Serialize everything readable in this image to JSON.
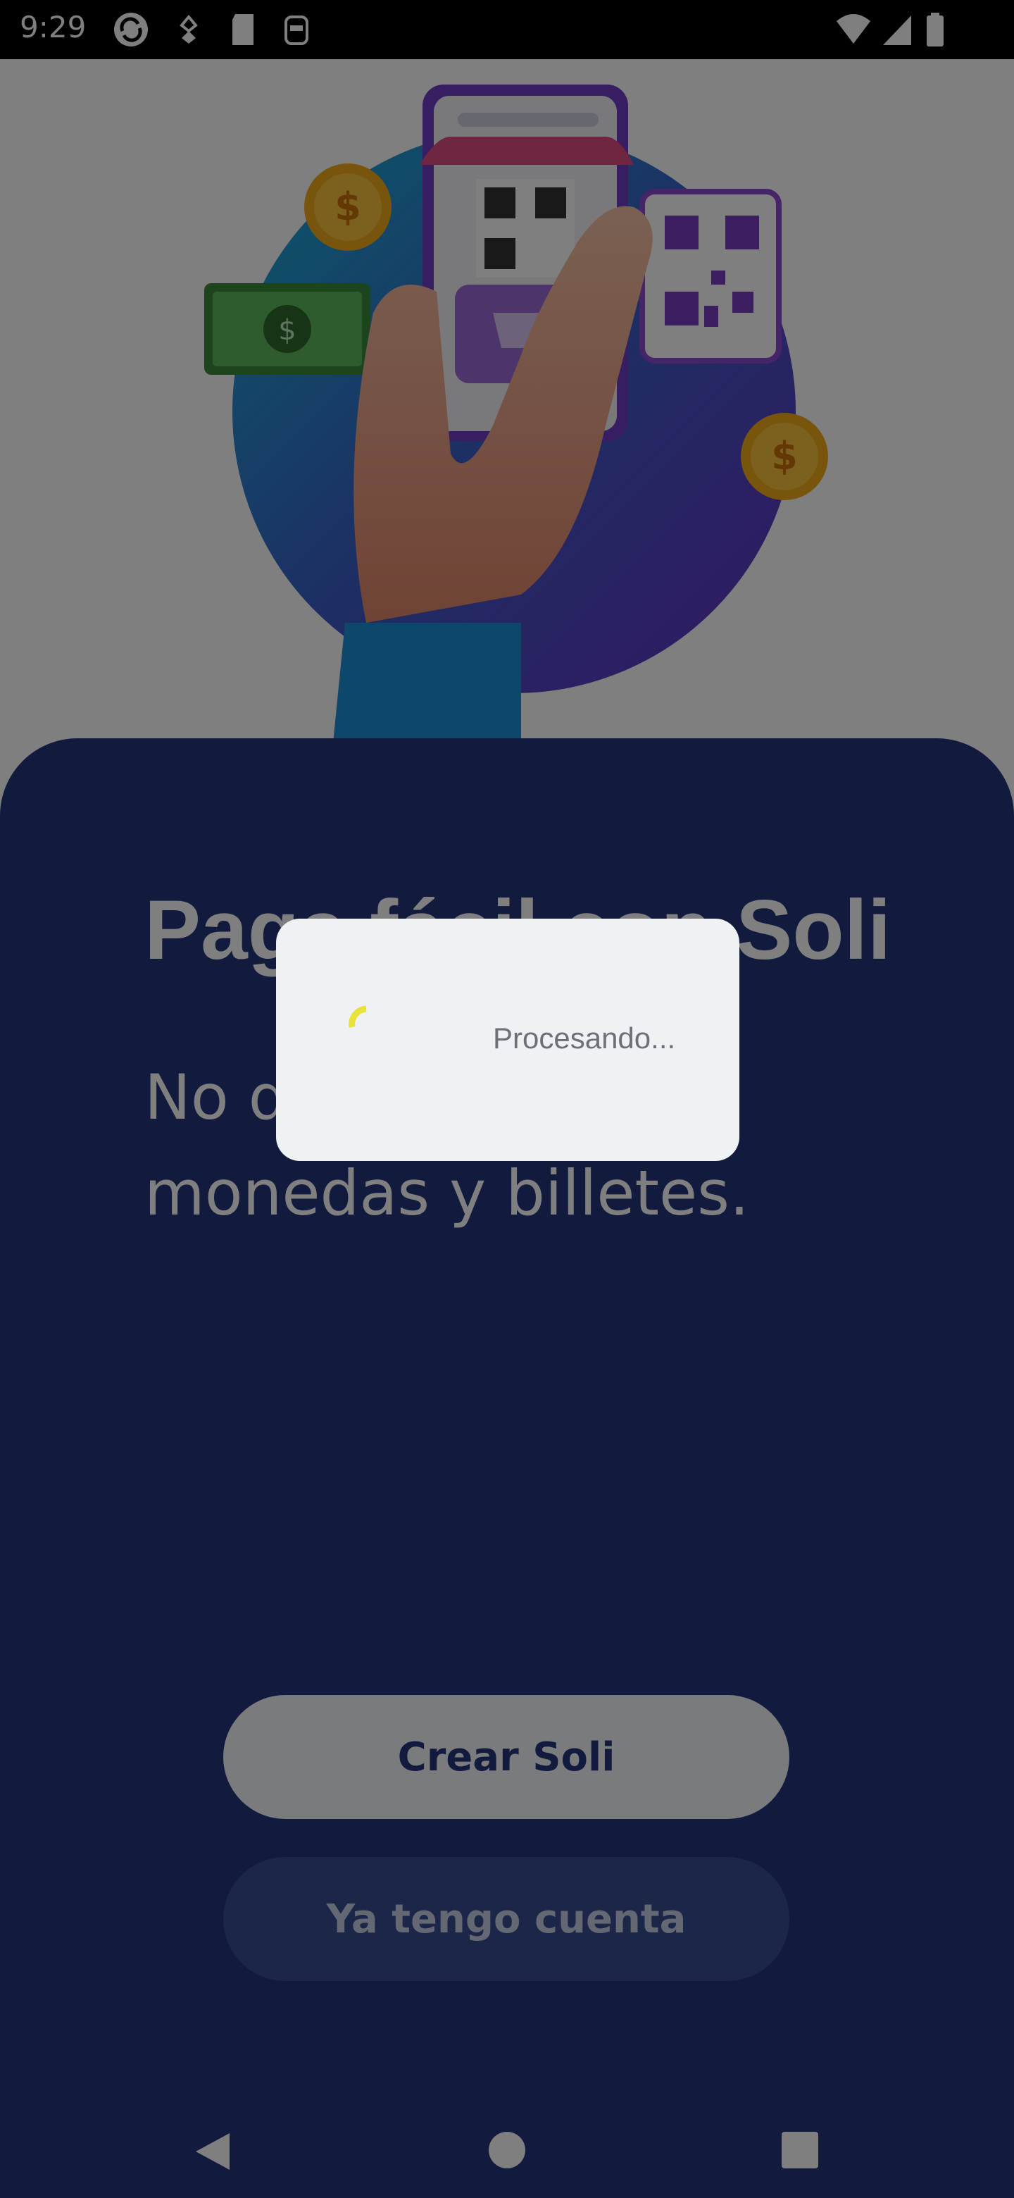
{
  "status_bar": {
    "time": "9:29",
    "icons": [
      "sync-icon",
      "sim-icon",
      "sd-card-icon",
      "screenshot-icon",
      "wifi-icon",
      "signal-icon",
      "battery-icon"
    ]
  },
  "main": {
    "headline": "Paga fácil con Soli",
    "subtitle": "No dependas de monedas y billetes."
  },
  "buttons": {
    "create_label": "Crear Soli",
    "login_label": "Ya tengo cuenta"
  },
  "dialog": {
    "message": "Procesando..."
  },
  "colors": {
    "panel": "#24367d",
    "spinner": "#e7e33a",
    "dialog_bg": "#eef2f4"
  },
  "nav_bar": {
    "icons": [
      "back-icon",
      "home-icon",
      "recents-icon"
    ]
  }
}
